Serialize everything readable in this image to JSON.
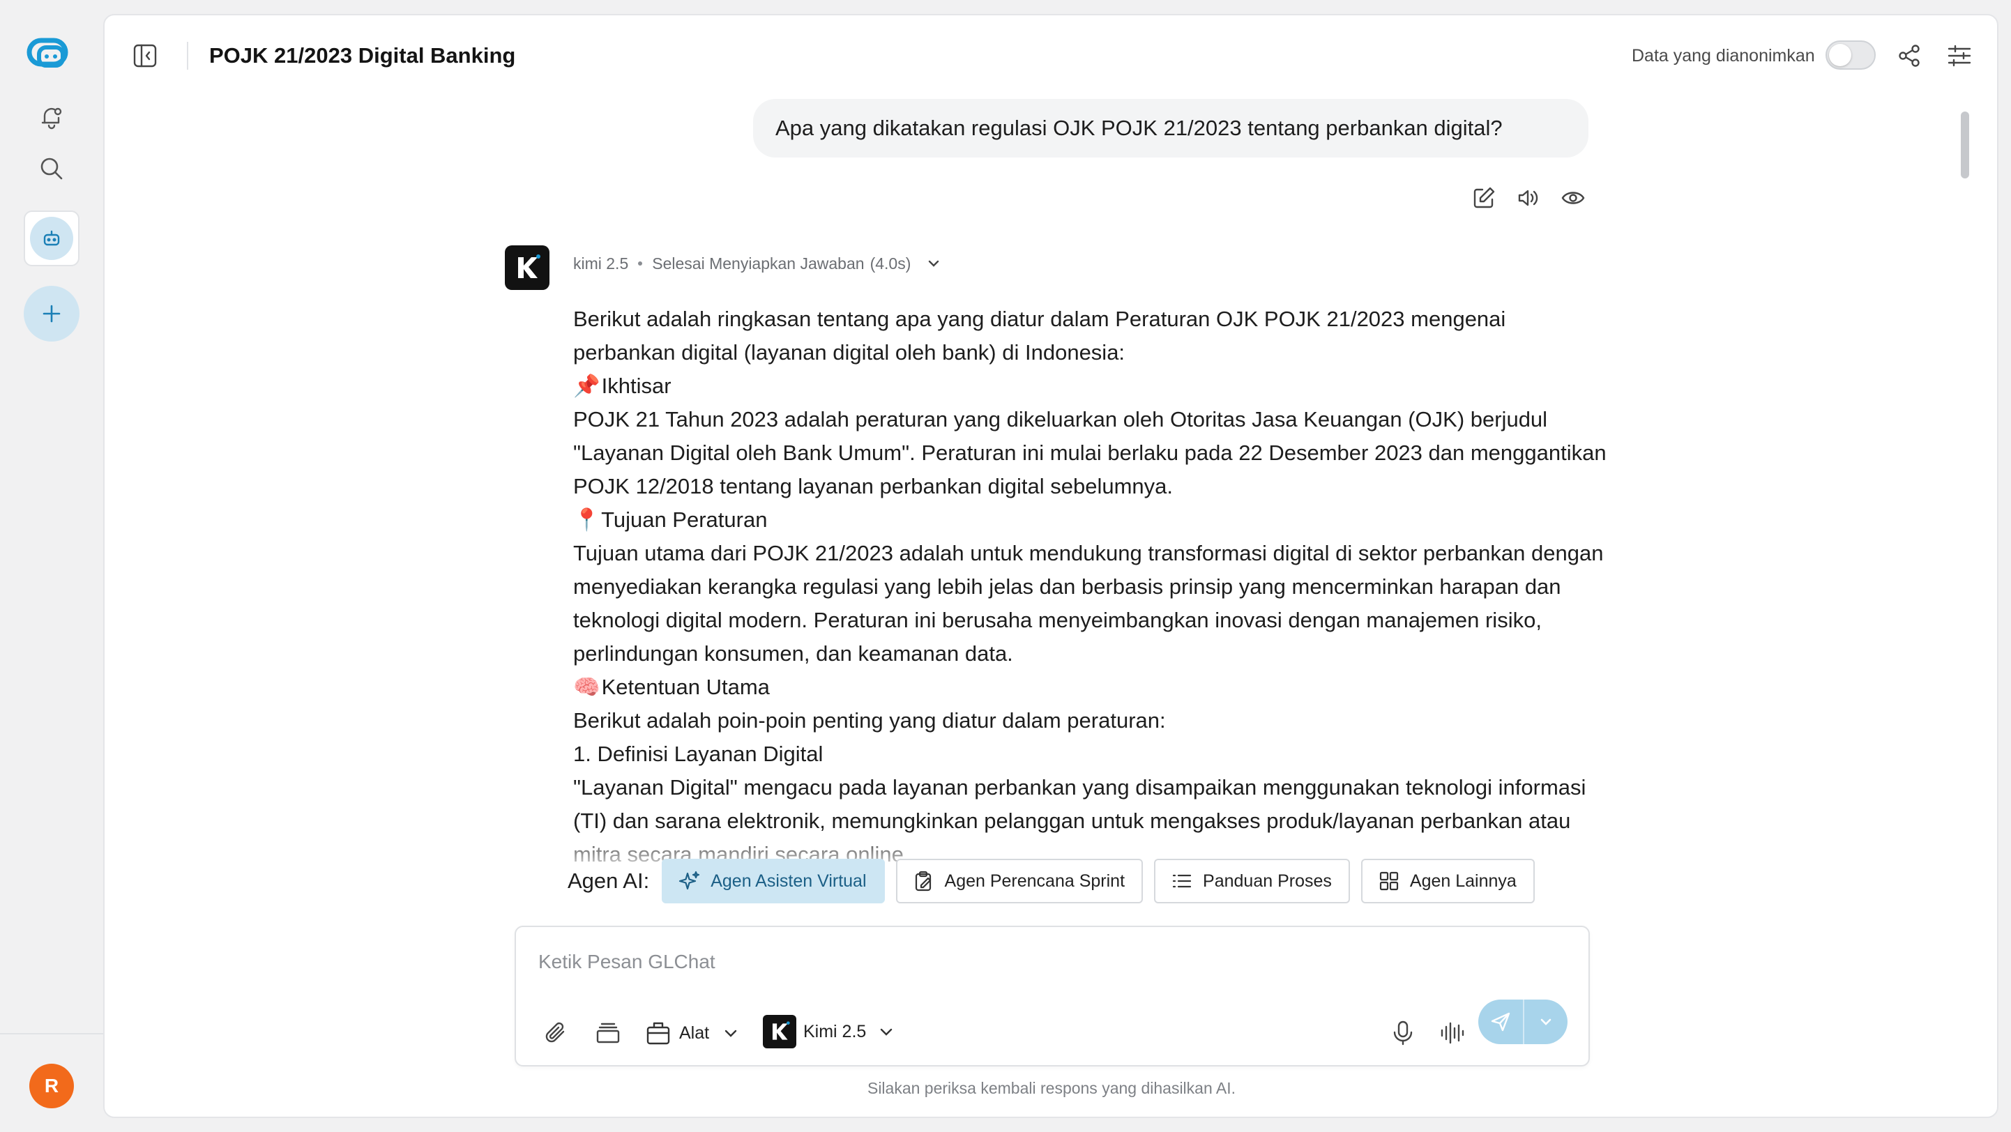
{
  "app": {
    "user_initial": "R"
  },
  "header": {
    "title": "POJK 21/2023 Digital Banking",
    "anonymize_label": "Data yang dianonimkan",
    "anonymize_on": false
  },
  "conversation": {
    "user_message": "Apa yang dikatakan regulasi OJK POJK 21/2023 tentang perbankan digital?",
    "assistant": {
      "model": "kimi 2.5",
      "status": "Selesai Menyiapkan Jawaban",
      "duration": "(4.0s)",
      "paragraphs": [
        "Berikut adalah ringkasan tentang apa yang diatur dalam Peraturan OJK POJK 21/2023 mengenai perbankan digital (layanan digital oleh bank) di Indonesia:",
        "Ikhtisar",
        "POJK 21 Tahun 2023 adalah peraturan yang dikeluarkan oleh Otoritas Jasa Keuangan (OJK) berjudul \"Layanan Digital oleh Bank Umum\". Peraturan ini mulai berlaku pada 22 Desember 2023 dan menggantikan POJK 12/2018 tentang layanan perbankan digital sebelumnya.",
        "Tujuan Peraturan",
        "Tujuan utama dari POJK 21/2023 adalah untuk mendukung transformasi digital di sektor perbankan dengan menyediakan kerangka regulasi yang lebih jelas dan berbasis prinsip yang mencerminkan harapan dan teknologi digital modern. Peraturan ini berusaha menyeimbangkan inovasi dengan manajemen risiko, perlindungan konsumen, dan keamanan data.",
        "Ketentuan Utama",
        "Berikut adalah poin-poin penting yang diatur dalam peraturan:",
        "1. Definisi Layanan Digital",
        "\"Layanan Digital\" mengacu pada layanan perbankan yang disampaikan menggunakan teknologi informasi (TI) dan sarana elektronik, memungkinkan pelanggan untuk mengakses produk/layanan perbankan atau mitra secara mandiri secara online."
      ],
      "emojis": {
        "overview": "📌",
        "purpose": "📍",
        "provisions": "🧠"
      }
    }
  },
  "agents": {
    "label": "Agen AI:",
    "items": [
      {
        "label": "Agen Asisten Virtual",
        "icon": "sparkle-icon",
        "active": true
      },
      {
        "label": "Agen Perencana Sprint",
        "icon": "clipboard-icon",
        "active": false
      },
      {
        "label": "Panduan Proses",
        "icon": "list-icon",
        "active": false
      },
      {
        "label": "Agen Lainnya",
        "icon": "grid-icon",
        "active": false
      }
    ]
  },
  "composer": {
    "placeholder": "Ketik Pesan GLChat",
    "tools_label": "Alat",
    "model_label": "Kimi 2.5"
  },
  "disclaimer": "Silakan periksa kembali respons yang dihasilkan AI.",
  "colors": {
    "accent": "#1a9ad6",
    "accent_light": "#cfe5f2",
    "send_button": "#a8d4eb",
    "avatar": "#f26a1b"
  }
}
